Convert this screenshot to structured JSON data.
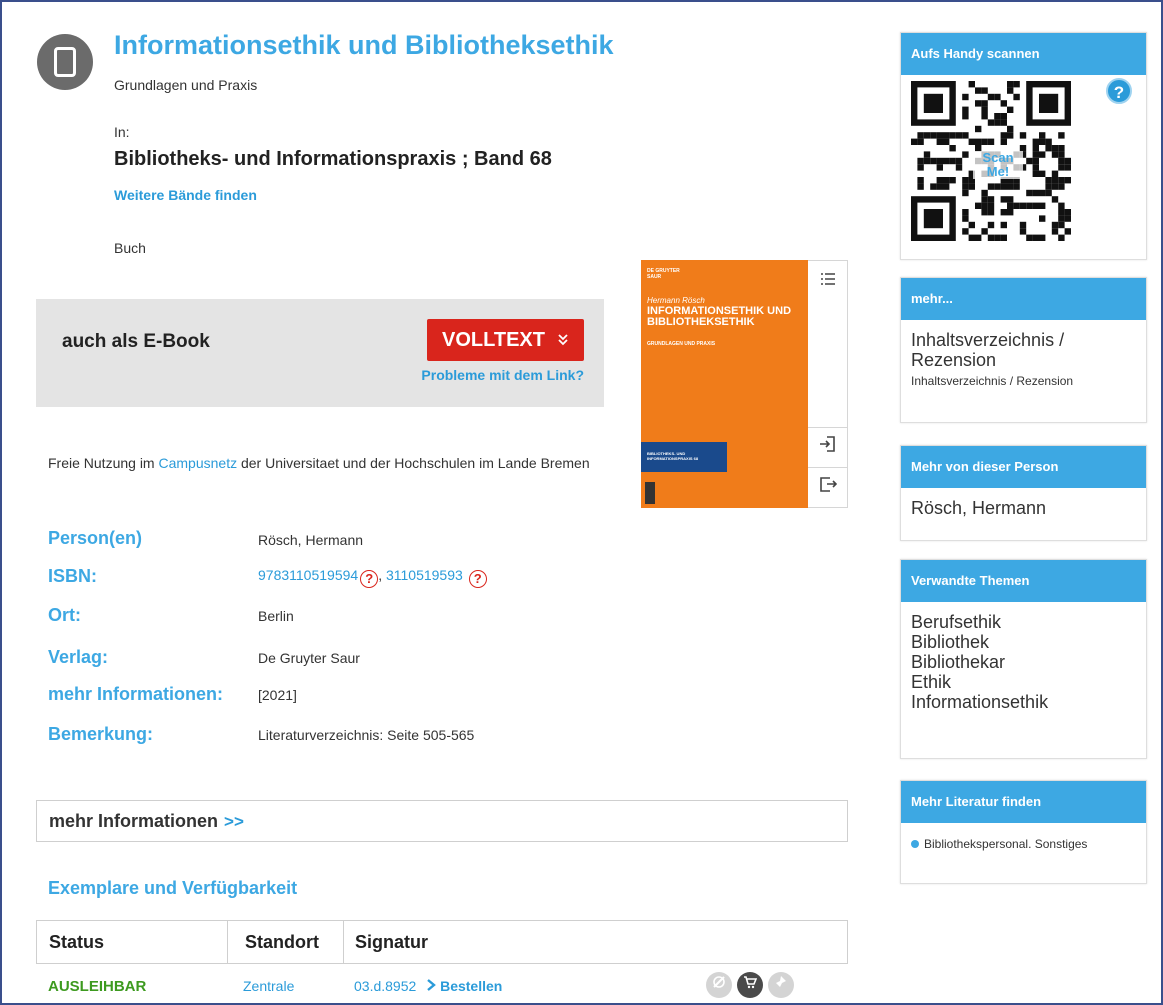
{
  "record": {
    "title": "Informationsethik und Bibliotheksethik",
    "subtitle": "Grundlagen und Praxis",
    "in_label": "In:",
    "series": "Bibliotheks- und Informationspraxis ; Band 68",
    "more_volumes_link": "Weitere Bände finden",
    "media_type": "Buch"
  },
  "ebook": {
    "label": "auch als E-Book",
    "volltext_button": "VOLLTEXT",
    "problem_link": "Probleme mit dem Link?"
  },
  "free_use": {
    "before": "Freie Nutzung im ",
    "link": "Campusnetz",
    "after": " der Universitaet und der Hochschulen im Lande Bremen"
  },
  "cover": {
    "publisher": "DE GRUYTER",
    "publisher_sub": "SAUR",
    "author": "Hermann Rösch",
    "title": "INFORMATIONSETHIK UND BIBLIOTHEKSETHIK",
    "subtitle": "GRUNDLAGEN UND PRAXIS",
    "series_band": "BIBLIOTHEKS- UND INFORMATIONSPRAXIS 68"
  },
  "details": {
    "person_label": "Person(en)",
    "person_value": "Rösch, Hermann",
    "isbn_label": "ISBN:",
    "isbn_1": "9783110519594",
    "isbn_sep": ", ",
    "isbn_2": "3110519593",
    "isbn_mark": "?",
    "ort_label": "Ort:",
    "ort_value": "Berlin",
    "verlag_label": "Verlag:",
    "verlag_value": "De Gruyter Saur",
    "mehr_label": "mehr Informationen:",
    "mehr_value": "[2021]",
    "bemerkung_label": "Bemerkung:",
    "bemerkung_value": "Literaturverzeichnis: Seite 505-565"
  },
  "more_info_bar": {
    "label": "mehr Informationen",
    "chevron": ">>"
  },
  "availability": {
    "heading": "Exemplare und Verfügbarkeit",
    "headers": [
      "Status",
      "Standort",
      "Signatur"
    ],
    "row": {
      "status": "AUSLEIHBAR",
      "standort": "Zentrale",
      "signatur": "03.d.8952",
      "order_link": "Bestellen"
    }
  },
  "sidebar": {
    "scan_heading": "Aufs Handy scannen",
    "scan_me": "Scan Me!",
    "help_icon": "?",
    "mehr_heading": "mehr...",
    "mehr_big": "Inhaltsverzeichnis / Rezension",
    "mehr_small": "Inhaltsverzeichnis / Rezension",
    "person_heading": "Mehr von dieser Person",
    "person_value": "Rösch, Hermann",
    "topics_heading": "Verwandte Themen",
    "topics": [
      "Berufsethik",
      "Bibliothek",
      "Bibliothekar",
      "Ethik",
      "Informationsethik"
    ],
    "lit_heading": "Mehr Literatur finden",
    "lit_item": "Bibliothekspersonal. Sonstiges"
  },
  "colors": {
    "accent_blue": "#3da8e3",
    "link_blue": "#2b9bd9",
    "volltext_red": "#d9251c",
    "available_green": "#3d9a1f",
    "cover_orange": "#f07c1a"
  },
  "icons": {
    "media": "book-icon",
    "volltext": "double-chevron-down-icon",
    "toc": "list-icon",
    "import": "login-icon",
    "export": "export-icon",
    "order": "chevron-right-icon",
    "actions": [
      "no-reserve-icon",
      "cart-icon",
      "pin-icon"
    ]
  }
}
